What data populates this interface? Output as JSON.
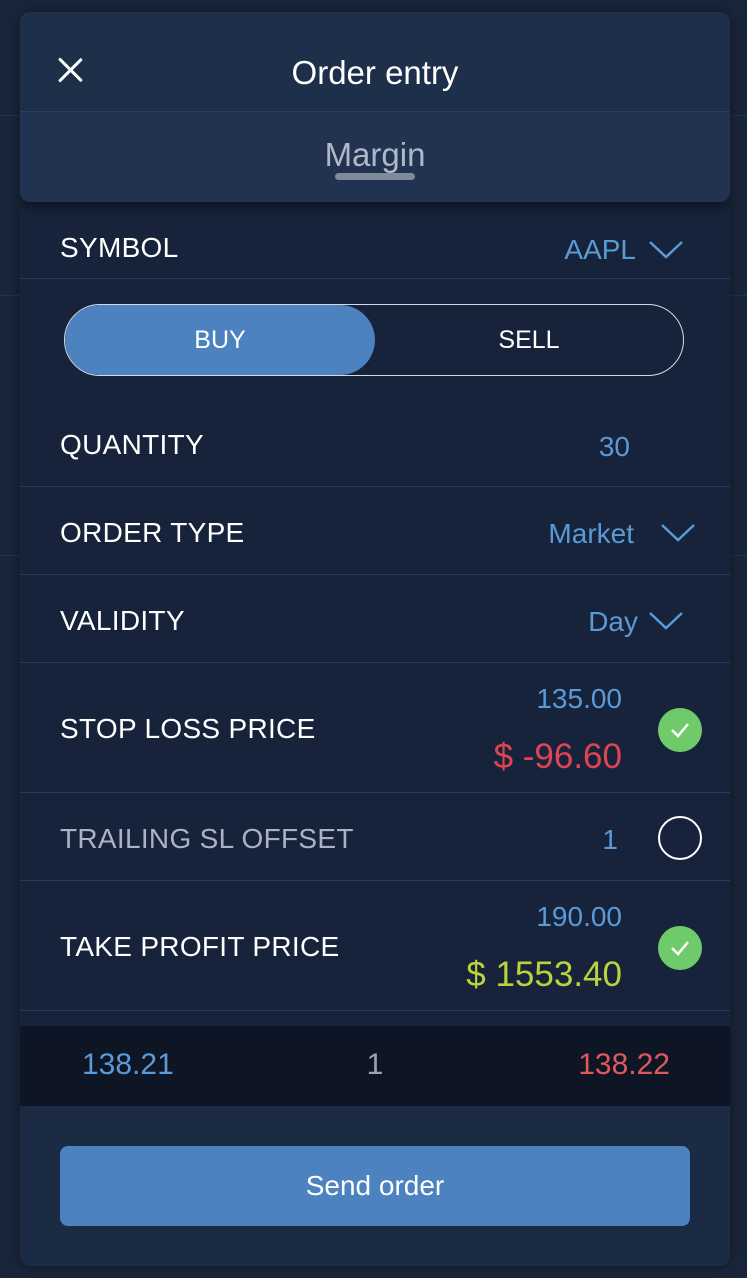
{
  "header": {
    "title": "Order entry",
    "tab": "Margin"
  },
  "symbol": {
    "label": "SYMBOL",
    "value": "AAPL"
  },
  "side": {
    "buy": "BUY",
    "sell": "SELL",
    "selected": "BUY"
  },
  "quantity": {
    "label": "QUANTITY",
    "value": "30"
  },
  "order_type": {
    "label": "ORDER TYPE",
    "value": "Market"
  },
  "validity": {
    "label": "VALIDITY",
    "value": "Day"
  },
  "stop_loss": {
    "label": "STOP LOSS PRICE",
    "price": "135.00",
    "pnl": "$ -96.60",
    "enabled": true
  },
  "trailing_sl": {
    "label": "TRAILING SL OFFSET",
    "value": "1",
    "enabled": false
  },
  "take_profit": {
    "label": "TAKE PROFIT PRICE",
    "price": "190.00",
    "pnl": "$ 1553.40",
    "enabled": true
  },
  "quote": {
    "bid": "138.21",
    "spread": "1",
    "ask": "138.22"
  },
  "actions": {
    "send": "Send order"
  },
  "colors": {
    "accent": "#4b82bf",
    "value_blue": "#5a9ad6",
    "loss_red": "#e04454",
    "profit_green": "#bcd23c",
    "check_green": "#6fca6a"
  }
}
